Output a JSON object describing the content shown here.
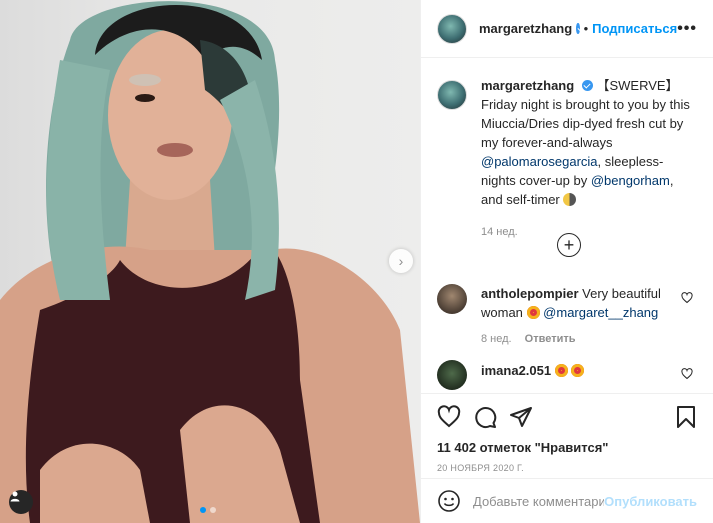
{
  "post": {
    "username": "margaretzhang",
    "follow_label": "Подписаться",
    "separator": "•",
    "more": "•••"
  },
  "caption": {
    "username": "margaretzhang",
    "text_1": "【SWERVE】Friday night is brought to you by this Miuccia/Dries dip-dyed fresh cut by my forever-and-always",
    "mention_1": "@palomarosegarcia",
    "text_2": ", sleepless-nights cover-up by",
    "mention_2": "@bengorham",
    "text_3": ", and self-timer",
    "time": "14 нед."
  },
  "comments": [
    {
      "username": "antholepompier",
      "text": "Very beautiful woman",
      "mention": "@margaret__zhang",
      "time": "8 нед.",
      "reply_label": "Ответить"
    },
    {
      "username": "imana2.051",
      "text": ""
    }
  ],
  "likes": "11 402 отметок \"Нравится\"",
  "date": "20 НОЯБРЯ 2020 Г.",
  "add_comment": {
    "placeholder": "Добавьте комментарий...",
    "publish": "Опубликовать"
  },
  "colors": {
    "accent": "#0095f6",
    "verified": "#3897f0",
    "mention": "#00376b",
    "muted": "#8e8e8e"
  },
  "icons": [
    "chevron-right-icon",
    "user-tag-icon",
    "plus-circle-icon",
    "heart-icon",
    "comment-icon",
    "share-icon",
    "bookmark-icon",
    "smile-icon",
    "moon-emoji",
    "heart-eyes-emoji"
  ]
}
